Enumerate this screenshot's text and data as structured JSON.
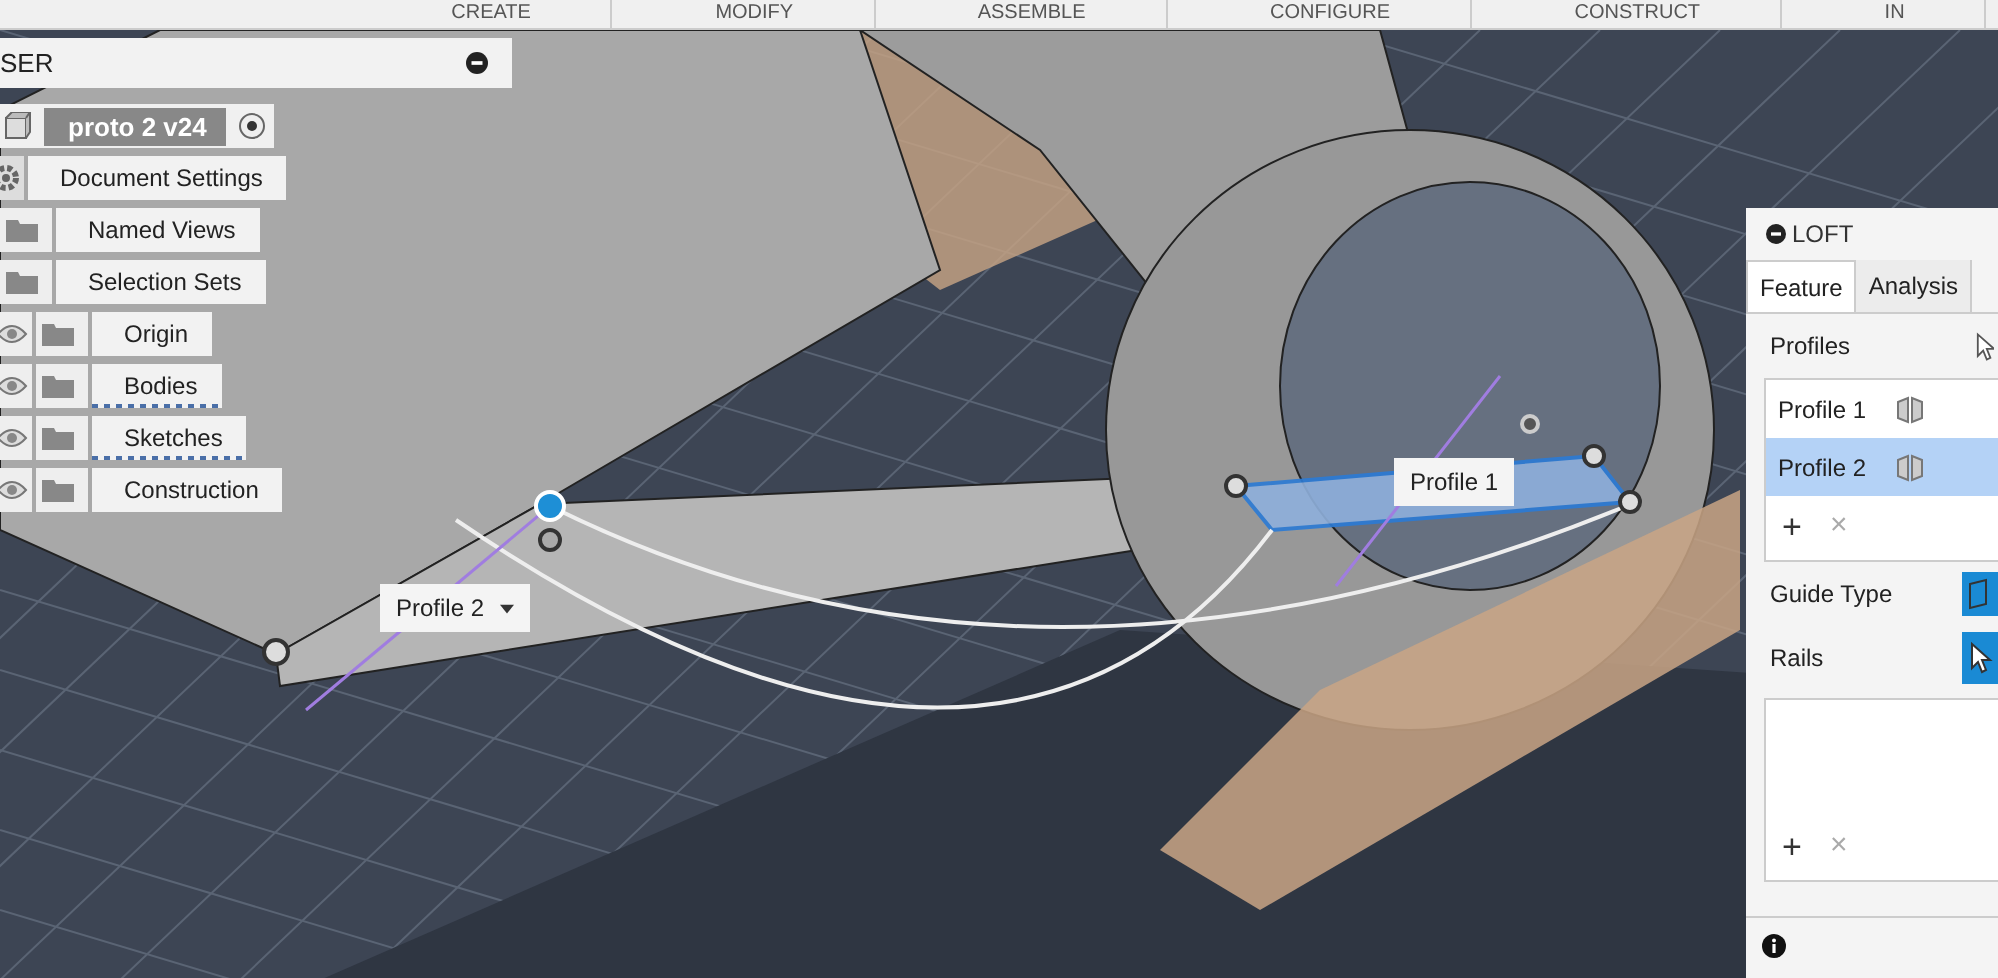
{
  "toolbar": {
    "items": [
      "CREATE",
      "MODIFY",
      "ASSEMBLE",
      "CONFIGURE",
      "CONSTRUCT",
      "IN"
    ]
  },
  "browser": {
    "title": "SER",
    "component": "proto 2 v24",
    "items": [
      {
        "label": "Document Settings",
        "kind": "settings",
        "eye": false,
        "highlighted": false
      },
      {
        "label": "Named Views",
        "kind": "folder",
        "eye": false,
        "highlighted": false
      },
      {
        "label": "Selection Sets",
        "kind": "folder",
        "eye": false,
        "highlighted": false
      },
      {
        "label": "Origin",
        "kind": "folder",
        "eye": true,
        "highlighted": false
      },
      {
        "label": "Bodies",
        "kind": "folder",
        "eye": true,
        "highlighted": true
      },
      {
        "label": "Sketches",
        "kind": "folder",
        "eye": true,
        "highlighted": true
      },
      {
        "label": "Construction",
        "kind": "folder",
        "eye": true,
        "highlighted": false
      }
    ]
  },
  "viewport": {
    "profile_labels": [
      {
        "label": "Profile 2",
        "dropdown": true
      },
      {
        "label": "Profile 1",
        "dropdown": false
      }
    ]
  },
  "loft": {
    "title": "LOFT",
    "tabs": [
      {
        "label": "Feature",
        "selected": true
      },
      {
        "label": "Analysis",
        "selected": false
      }
    ],
    "profiles_label": "Profiles",
    "profiles": [
      {
        "label": "Profile 1",
        "selected": false
      },
      {
        "label": "Profile 2",
        "selected": true
      }
    ],
    "profile_actions": [
      "+",
      "×"
    ],
    "guide_type_label": "Guide Type",
    "rails_label": "Rails",
    "rail_actions": [
      "+",
      "×"
    ]
  }
}
